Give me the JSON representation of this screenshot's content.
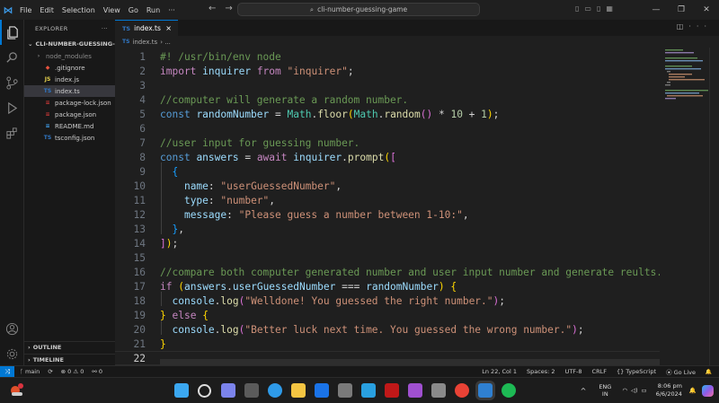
{
  "menu": [
    "File",
    "Edit",
    "Selection",
    "View",
    "Go",
    "Run",
    "···"
  ],
  "search": {
    "text": "cli-number-guessing-game"
  },
  "explorer": {
    "title": "EXPLORER",
    "more": "···",
    "folder": "CLI-NUMBER-GUESSING-G...",
    "files": [
      {
        "name": "node_modules",
        "icon": "›",
        "color": "#8a8a8a"
      },
      {
        "name": ".gitignore",
        "icon": "◆",
        "color": "#e8533f"
      },
      {
        "name": "index.js",
        "icon": "JS",
        "color": "#e8d44d"
      },
      {
        "name": "index.ts",
        "icon": "TS",
        "color": "#3178c6"
      },
      {
        "name": "package-lock.json",
        "icon": "≡",
        "color": "#cb3837"
      },
      {
        "name": "package.json",
        "icon": "≡",
        "color": "#cb3837"
      },
      {
        "name": "README.md",
        "icon": "≡",
        "color": "#42a5f5"
      },
      {
        "name": "tsconfig.json",
        "icon": "TS",
        "color": "#3178c6"
      }
    ],
    "outline": "OUTLINE",
    "timeline": "TIMELINE"
  },
  "tab": {
    "label": "index.ts",
    "icon": "TS",
    "close": "×"
  },
  "breadcrumb": {
    "file": "index.ts",
    "rest": "› ..."
  },
  "code": [
    [
      [
        "c-cmt",
        "#! /usr/bin/env node"
      ]
    ],
    [
      [
        "c-ctl",
        "import"
      ],
      [
        "c-plain",
        " "
      ],
      [
        "c-var",
        "inquirer"
      ],
      [
        "c-plain",
        " "
      ],
      [
        "c-ctl",
        "from"
      ],
      [
        "c-plain",
        " "
      ],
      [
        "c-str",
        "\"inquirer\""
      ],
      [
        "c-plain",
        ";"
      ]
    ],
    [],
    [
      [
        "c-cmt",
        "//computer will generate a random number."
      ]
    ],
    [
      [
        "c-kw",
        "const"
      ],
      [
        "c-plain",
        " "
      ],
      [
        "c-var",
        "randomNumber"
      ],
      [
        "c-plain",
        " = "
      ],
      [
        "c-cls",
        "Math"
      ],
      [
        "c-plain",
        "."
      ],
      [
        "c-fn",
        "floor"
      ],
      [
        "c-b1",
        "("
      ],
      [
        "c-cls",
        "Math"
      ],
      [
        "c-plain",
        "."
      ],
      [
        "c-fn",
        "random"
      ],
      [
        "c-b2",
        "()"
      ],
      [
        "c-plain",
        " * "
      ],
      [
        "c-num",
        "10"
      ],
      [
        "c-plain",
        " + "
      ],
      [
        "c-num",
        "1"
      ],
      [
        "c-b1",
        ")"
      ],
      [
        "c-plain",
        ";"
      ]
    ],
    [],
    [
      [
        "c-cmt",
        "//user input for guessing number."
      ]
    ],
    [
      [
        "c-kw",
        "const"
      ],
      [
        "c-plain",
        " "
      ],
      [
        "c-var",
        "answers"
      ],
      [
        "c-plain",
        " = "
      ],
      [
        "c-ctl",
        "await"
      ],
      [
        "c-plain",
        " "
      ],
      [
        "c-var",
        "inquirer"
      ],
      [
        "c-plain",
        "."
      ],
      [
        "c-fn",
        "prompt"
      ],
      [
        "c-b1",
        "("
      ],
      [
        "c-b2",
        "["
      ]
    ],
    [
      [
        "c-plain",
        "  "
      ],
      [
        "c-b3",
        "{"
      ]
    ],
    [
      [
        "c-plain",
        "    "
      ],
      [
        "c-var",
        "name"
      ],
      [
        "c-plain",
        ": "
      ],
      [
        "c-str",
        "\"userGuessedNumber\""
      ],
      [
        "c-plain",
        ","
      ]
    ],
    [
      [
        "c-plain",
        "    "
      ],
      [
        "c-var",
        "type"
      ],
      [
        "c-plain",
        ": "
      ],
      [
        "c-str",
        "\"number\""
      ],
      [
        "c-plain",
        ","
      ]
    ],
    [
      [
        "c-plain",
        "    "
      ],
      [
        "c-var",
        "message"
      ],
      [
        "c-plain",
        ": "
      ],
      [
        "c-str",
        "\"Please guess a number between 1-10:\""
      ],
      [
        "c-plain",
        ","
      ]
    ],
    [
      [
        "c-plain",
        "  "
      ],
      [
        "c-b3",
        "}"
      ],
      [
        "c-plain",
        ","
      ]
    ],
    [
      [
        "c-b2",
        "]"
      ],
      [
        "c-b1",
        ")"
      ],
      [
        "c-plain",
        ";"
      ]
    ],
    [],
    [
      [
        "c-cmt",
        "//compare both computer generated number and user input number and generate reults."
      ]
    ],
    [
      [
        "c-ctl",
        "if"
      ],
      [
        "c-plain",
        " "
      ],
      [
        "c-b1",
        "("
      ],
      [
        "c-var",
        "answers"
      ],
      [
        "c-plain",
        "."
      ],
      [
        "c-var",
        "userGuessedNumber"
      ],
      [
        "c-plain",
        " === "
      ],
      [
        "c-var",
        "randomNumber"
      ],
      [
        "c-b1",
        ")"
      ],
      [
        "c-plain",
        " "
      ],
      [
        "c-b1",
        "{"
      ]
    ],
    [
      [
        "c-plain",
        "  "
      ],
      [
        "c-var",
        "console"
      ],
      [
        "c-plain",
        "."
      ],
      [
        "c-fn",
        "log"
      ],
      [
        "c-b2",
        "("
      ],
      [
        "c-str",
        "\"Welldone! You guessed the right number.\""
      ],
      [
        "c-b2",
        ")"
      ],
      [
        "c-plain",
        ";"
      ]
    ],
    [
      [
        "c-b1",
        "}"
      ],
      [
        "c-plain",
        " "
      ],
      [
        "c-ctl",
        "else"
      ],
      [
        "c-plain",
        " "
      ],
      [
        "c-b1",
        "{"
      ]
    ],
    [
      [
        "c-plain",
        "  "
      ],
      [
        "c-var",
        "console"
      ],
      [
        "c-plain",
        "."
      ],
      [
        "c-fn",
        "log"
      ],
      [
        "c-b2",
        "("
      ],
      [
        "c-str",
        "\"Better luck next time. You guessed the wrong number.\""
      ],
      [
        "c-b2",
        ")"
      ],
      [
        "c-plain",
        ";"
      ]
    ],
    [
      [
        "c-b1",
        "}"
      ]
    ],
    []
  ],
  "status": {
    "remote": "⤨",
    "branch": "ᚴ main",
    "sync": "⟳",
    "problems": "⊗ 0 ⚠ 0",
    "ports": "⚯ 0",
    "cursor": "Ln 22, Col 1",
    "spaces": "Spaces: 2",
    "encoding": "UTF-8",
    "eol": "CRLF",
    "language": "{} TypeScript",
    "golive": "⦿ Go Live",
    "bell": "🔔"
  },
  "taskbar": {
    "lang": [
      "ENG",
      "IN"
    ],
    "time": "8:06 pm",
    "date": "6/6/2024",
    "chevron": "^",
    "apps": [
      {
        "name": "windows-start-icon",
        "color": "#3ba7f0"
      },
      {
        "name": "search-icon",
        "color": "#dddddd"
      },
      {
        "name": "chat-icon",
        "color": "#7b83eb"
      },
      {
        "name": "widgets-icon",
        "color": "#5b5b5b"
      },
      {
        "name": "edge-icon",
        "color": "#2e9ae8"
      },
      {
        "name": "file-explorer-icon",
        "color": "#f4c542"
      },
      {
        "name": "meet-icon",
        "color": "#1a73e8"
      },
      {
        "name": "store-icon",
        "color": "#7a7a7a"
      },
      {
        "name": "app-blue-icon",
        "color": "#29a0e0"
      },
      {
        "name": "mcafee-icon",
        "color": "#c01818"
      },
      {
        "name": "app-purple-icon",
        "color": "#a050d0"
      },
      {
        "name": "settings-icon",
        "color": "#8a8a8a"
      },
      {
        "name": "chrome-icon",
        "color": "#e94235"
      },
      {
        "name": "vscode-icon",
        "color": "#2f80d1"
      },
      {
        "name": "spotify-icon",
        "color": "#1db954"
      }
    ]
  }
}
